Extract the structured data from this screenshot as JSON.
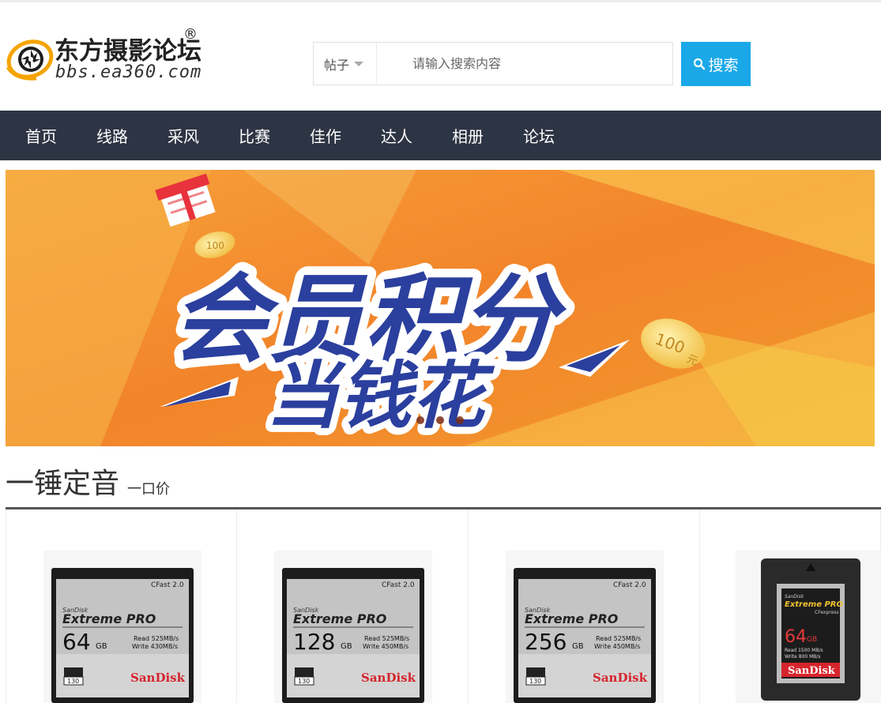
{
  "site": {
    "name": "东方摄影论坛",
    "reg_mark": "®",
    "domain": "bbs.ea360.com",
    "logo_icon": "aperture-icon"
  },
  "search": {
    "type_label": "帖子",
    "placeholder": "请输入搜索内容",
    "button_label": "搜索"
  },
  "nav": {
    "items": [
      "首页",
      "线路",
      "采风",
      "比赛",
      "佳作",
      "达人",
      "相册",
      "论坛"
    ]
  },
  "banner": {
    "headline": "会员积分",
    "subline": "当钱花",
    "coin_label": "100",
    "coin_unit": "元",
    "slides": 3
  },
  "section": {
    "title": "一锤定音",
    "subtitle": "一口价"
  },
  "products": [
    {
      "brand": "SanDisk",
      "series": "Extreme PRO",
      "format": "CFast 2.0",
      "capacity": "64",
      "unit": "GB",
      "read": "Read 525MB/s",
      "write": "Write 430MB/s",
      "vpg": "130"
    },
    {
      "brand": "SanDisk",
      "series": "Extreme PRO",
      "format": "CFast 2.0",
      "capacity": "128",
      "unit": "GB",
      "read": "Read 525MB/s",
      "write": "Write 450MB/s",
      "vpg": "130"
    },
    {
      "brand": "SanDisk",
      "series": "Extreme PRO",
      "format": "CFast 2.0",
      "capacity": "256",
      "unit": "GB",
      "read": "Read 525MB/s",
      "write": "Write 450MB/s",
      "vpg": "130"
    },
    {
      "brand": "SanDisk",
      "series": "Extreme PRO",
      "format": "CFexpress",
      "capacity": "64",
      "unit": "GB",
      "read": "Read 1500 MB/s",
      "write": "Write 800 MB/s"
    }
  ],
  "colors": {
    "nav_bg": "#2d3443",
    "search_btn": "#1aa8e8",
    "logo_orange": "#f5a400",
    "banner_orange": "#f08a2a",
    "headline_blue": "#2b3f9e",
    "headline_purple": "#6a2f8c",
    "sandisk_red": "#d6242c"
  }
}
